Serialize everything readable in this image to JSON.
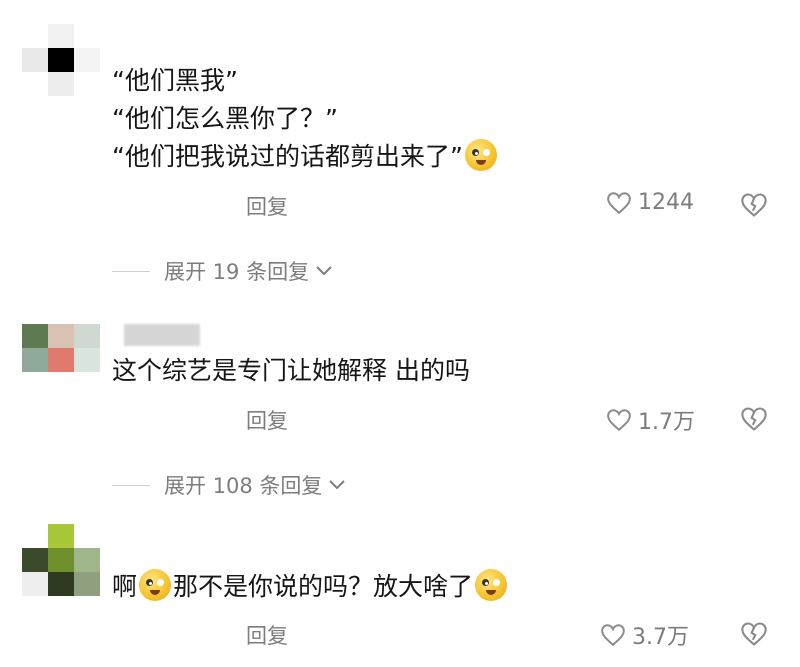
{
  "comments": [
    {
      "lines": [
        "“他们黑我”",
        "“他们怎么黑你了？”",
        "“他们把我说过的话都剪出来了”"
      ],
      "reply_label": "回复",
      "likes": "1244",
      "expand_label": "展开 19 条回复",
      "avatar_colors": [
        "#ffffff",
        "#f2f2f2",
        "#ffffff",
        "#e8e8e8",
        "#000000",
        "#f4f4f4",
        "#ffffff",
        "#ededed",
        "#ffffff"
      ]
    },
    {
      "lines": [
        "这个综艺是专门让她解释 出的吗"
      ],
      "reply_label": "回复",
      "likes": "1.7万",
      "expand_label": "展开 108 条回复",
      "avatar_colors": [
        "#5e7a52",
        "#d9c2b3",
        "#cfd9d2",
        "#8fa99a",
        "#e07a6e",
        "#d9e6de",
        "#ffffff",
        "#ffffff",
        "#ffffff"
      ]
    },
    {
      "lines_prefix": "啊",
      "lines_mid": "那不是你说的吗？放大啥了",
      "reply_label": "回复",
      "likes": "3.7万",
      "avatar_colors": [
        "#ffffff",
        "#a8c83a",
        "#ffffff",
        "#3b4a2a",
        "#6e8f2c",
        "#9fb68a",
        "#eeeeee",
        "#2e3a22",
        "#8ea07e"
      ]
    }
  ],
  "colors": {
    "text": "#161616",
    "secondary": "#7d7d7d",
    "emoji": "#f6c12c"
  },
  "icons": {
    "like": "heart-outline-icon",
    "dislike": "broken-heart-icon",
    "expand": "chevron-down-icon",
    "emoji": "emoji-face-icon"
  }
}
